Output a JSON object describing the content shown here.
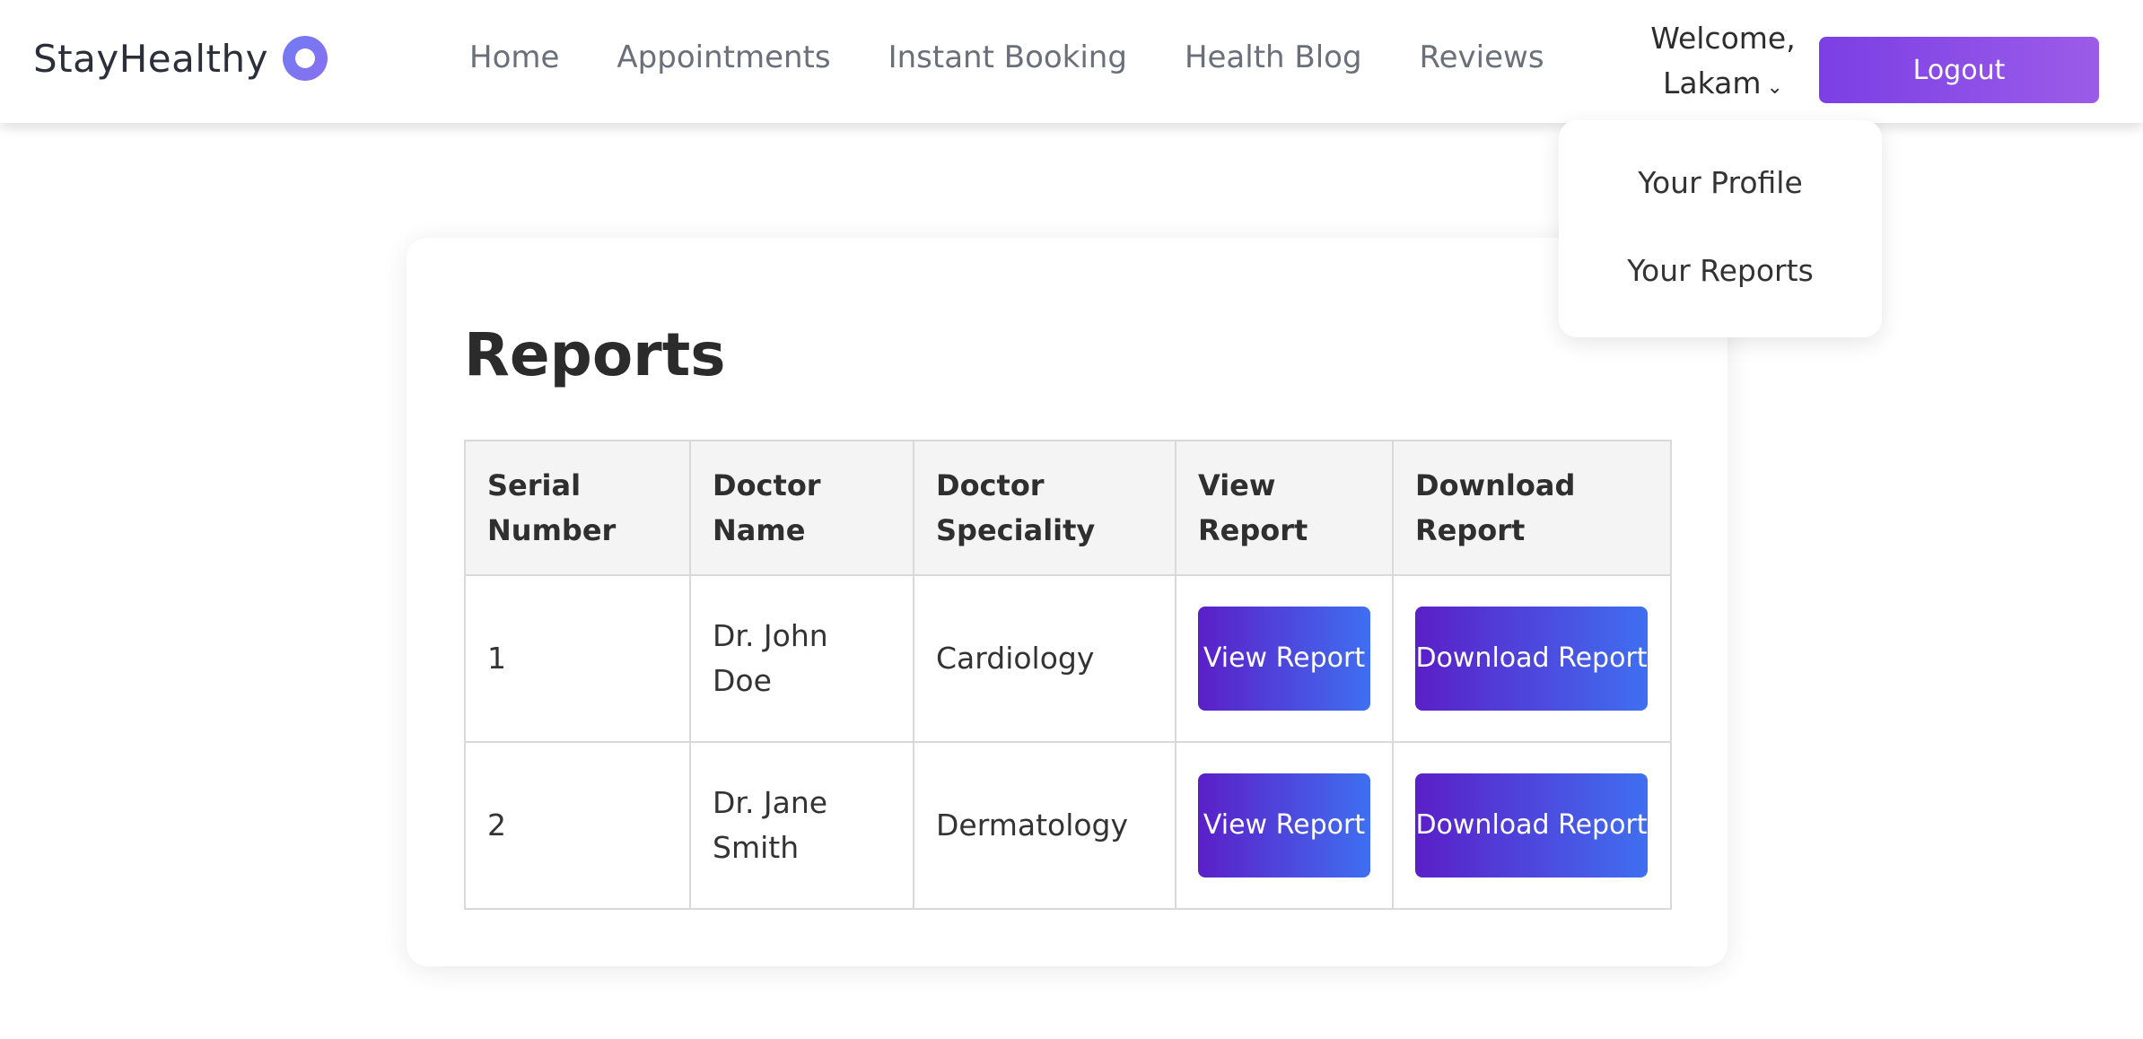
{
  "header": {
    "brand": "StayHealthy",
    "nav": [
      "Home",
      "Appointments",
      "Instant Booking",
      "Health Blog",
      "Reviews"
    ],
    "welcome_line1": "Welcome,",
    "welcome_line2": "Lakam",
    "chevron": "⌄",
    "logout_label": "Logout"
  },
  "dropdown": {
    "items": [
      "Your Profile",
      "Your Reports"
    ]
  },
  "main": {
    "title": "Reports",
    "columns": [
      "Serial Number",
      "Doctor Name",
      "Doctor Speciality",
      "View Report",
      "Download Report"
    ],
    "rows": [
      {
        "serial": "1",
        "doctor": "Dr. John Doe",
        "speciality": "Cardiology",
        "view_label": "View Report",
        "download_label": "Download Report"
      },
      {
        "serial": "2",
        "doctor": "Dr. Jane Smith",
        "speciality": "Dermatology",
        "view_label": "View Report",
        "download_label": "Download Report"
      }
    ]
  },
  "colors": {
    "accent": "#7b3fe4",
    "button_gradient_start": "#5b1fc8",
    "button_gradient_end": "#3f6ff0",
    "logo": "#6f7cf2"
  }
}
